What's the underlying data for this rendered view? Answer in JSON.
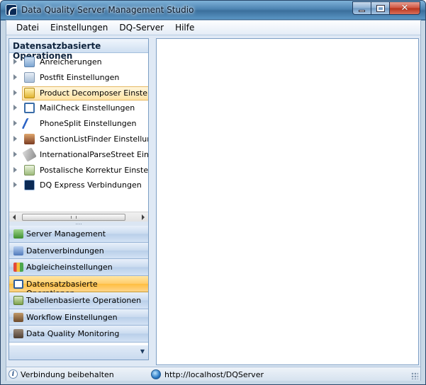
{
  "window": {
    "title": "Data Quality Server Management Studio"
  },
  "menu": [
    "Datei",
    "Einstellungen",
    "DQ-Server",
    "Hilfe"
  ],
  "left_panel": {
    "header": "Datensatzbasierte Operationen",
    "tree_items": [
      {
        "label": "Anreicherungen",
        "icon": "enrichment-icon"
      },
      {
        "label": "Postfit Einstellungen",
        "icon": "postfit-icon"
      },
      {
        "label": "Product Decomposer Einstellungen",
        "icon": "product-decomposer-icon",
        "selected": true
      },
      {
        "label": "MailCheck Einstellungen",
        "icon": "at-sign-icon"
      },
      {
        "label": "PhoneSplit Einstellungen",
        "icon": "phone-icon"
      },
      {
        "label": "SanctionListFinder Einstellungen",
        "icon": "person-icon"
      },
      {
        "label": "InternationalParseStreet Einstellungen",
        "icon": "street-icon"
      },
      {
        "label": "Postalische Korrektur Einstellungen",
        "icon": "postal-correction-icon"
      },
      {
        "label": "DQ Express Verbindungen",
        "icon": "dq-express-icon"
      }
    ],
    "splitter_grip": "....",
    "nav_buttons": [
      {
        "label": "Server Management",
        "icon": "server-icon"
      },
      {
        "label": "Datenverbindungen",
        "icon": "data-connection-icon"
      },
      {
        "label": "Abgleicheinstellungen",
        "icon": "matching-icon"
      },
      {
        "label": "Datensatzbasierte Operationen",
        "icon": "record-operations-icon",
        "active": true
      },
      {
        "label": "Tabellenbasierte Operationen",
        "icon": "table-operations-icon"
      },
      {
        "label": "Workflow Einstellungen",
        "icon": "workflow-icon"
      },
      {
        "label": "Data Quality Monitoring",
        "icon": "monitoring-icon"
      }
    ],
    "footer_arrow": "▼"
  },
  "status": {
    "info_glyph": "i",
    "left_text": "Verbindung beibehalten",
    "server_url": "http://localhost/DQServer"
  }
}
